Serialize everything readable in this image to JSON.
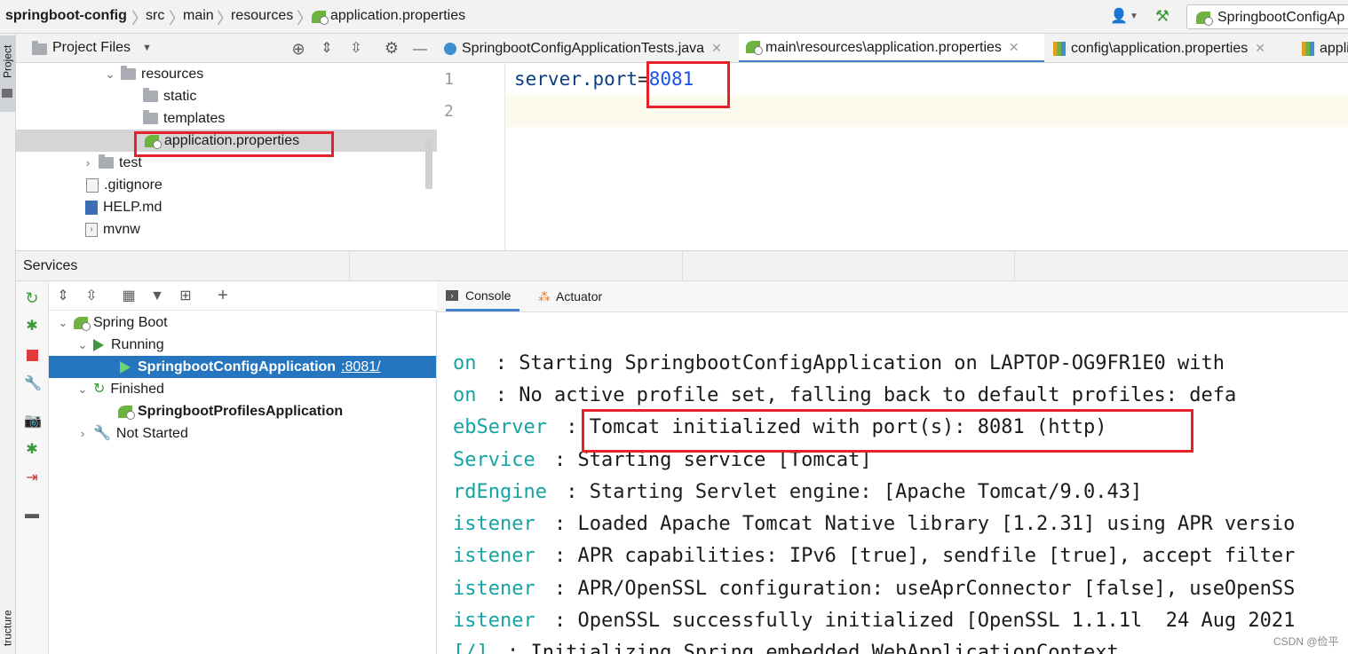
{
  "navbar": {
    "breadcrumbs": [
      "springboot-config",
      "src",
      "main",
      "resources",
      "application.properties"
    ],
    "run_config": "SpringbootConfigAp"
  },
  "left_strip": {
    "project_tab": "Project",
    "structure_tab": "tructure"
  },
  "project": {
    "title": "Project Files",
    "tree": [
      {
        "label": "resources",
        "type": "folder",
        "expanded": true
      },
      {
        "label": "static",
        "type": "folder"
      },
      {
        "label": "templates",
        "type": "folder"
      },
      {
        "label": "application.properties",
        "type": "spring-file",
        "selected": true
      },
      {
        "label": "test",
        "type": "folder",
        "expanded": false
      },
      {
        "label": ".gitignore",
        "type": "file"
      },
      {
        "label": "HELP.md",
        "type": "md"
      },
      {
        "label": "mvnw",
        "type": "exec"
      }
    ]
  },
  "editor": {
    "tabs": [
      {
        "label": "SpringbootConfigApplicationTests.java"
      },
      {
        "label": "main\\resources\\application.properties",
        "active": true
      },
      {
        "label": "config\\application.properties"
      },
      {
        "label": "appli"
      }
    ],
    "line_numbers": [
      "1",
      "2"
    ],
    "code": {
      "key": "server.port",
      "eq": "=",
      "value": "8081"
    }
  },
  "services": {
    "title": "Services",
    "tree": {
      "root": "Spring Boot",
      "running": "Running",
      "running_app": "SpringbootConfigApplication",
      "running_port": ":8081/",
      "finished": "Finished",
      "finished_app": "SpringbootProfilesApplication",
      "not_started": "Not Started"
    }
  },
  "console": {
    "tabs": [
      "Console",
      "Actuator"
    ],
    "lines": [
      {
        "logger": "on",
        "message": " : Starting SpringbootConfigApplication on LAPTOP-OG9FR1E0 with"
      },
      {
        "logger": "on",
        "message": " : No active profile set, falling back to default profiles: defa"
      },
      {
        "logger": "ebServer",
        "message": " : Tomcat initialized with port(s): 8081 (http)"
      },
      {
        "logger": "Service",
        "message": " : Starting service [Tomcat]"
      },
      {
        "logger": "rdEngine",
        "message": " : Starting Servlet engine: [Apache Tomcat/9.0.43]"
      },
      {
        "logger": "istener",
        "message": " : Loaded Apache Tomcat Native library [1.2.31] using APR versio"
      },
      {
        "logger": "istener",
        "message": " : APR capabilities: IPv6 [true], sendfile [true], accept filter"
      },
      {
        "logger": "istener",
        "message": " : APR/OpenSSL configuration: useAprConnector [false], useOpenSS"
      },
      {
        "logger": "istener",
        "message": " : OpenSSL successfully initialized [OpenSSL 1.1.1l  24 Aug 2021"
      },
      {
        "logger": "[/]",
        "message": " : Initializing Spring embedded WebApplicationContext"
      }
    ]
  },
  "watermark": "CSDN @俭平",
  "colors": {
    "highlight": "#e8202a",
    "selection": "#2675bf",
    "logger": "#16a3a3",
    "number": "#1750eb"
  }
}
